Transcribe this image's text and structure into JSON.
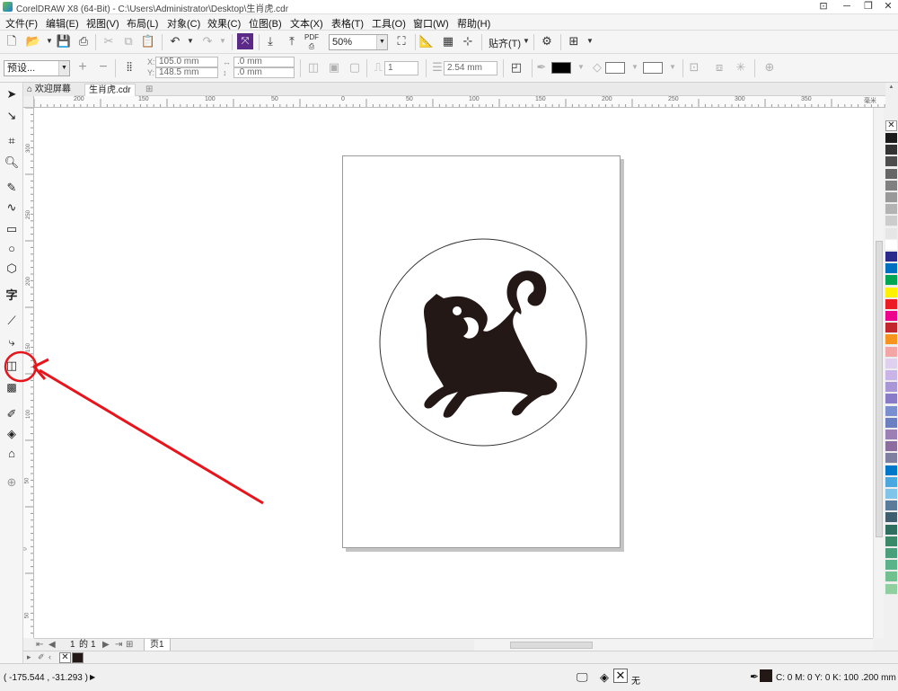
{
  "window": {
    "title": "CorelDRAW X8 (64-Bit) - C:\\Users\\Administrator\\Desktop\\生肖虎.cdr",
    "controls": [
      "restore-icon",
      "minimize-icon",
      "maximize-icon",
      "close-icon"
    ]
  },
  "menu": [
    "文件(F)",
    "编辑(E)",
    "视图(V)",
    "布局(L)",
    "对象(C)",
    "效果(C)",
    "位图(B)",
    "文本(X)",
    "表格(T)",
    "工具(O)",
    "窗口(W)",
    "帮助(H)"
  ],
  "toolbar": {
    "zoom": "50%",
    "snap_label": "贴齐(T)",
    "pdf_label": "PDF"
  },
  "property_bar": {
    "preset": "预设...",
    "x": "105.0 mm",
    "y": "148.5 mm",
    "x_label": "X:",
    "y_label": "Y:",
    "w": ".0 mm",
    "h": ".0 mm",
    "corner_count": "1",
    "outline_width": "2.54 mm"
  },
  "tabs": [
    {
      "label": "欢迎屏幕",
      "icon": "home-icon",
      "active": false
    },
    {
      "label": "生肖虎.cdr",
      "active": true
    }
  ],
  "rulers": {
    "horizontal": [
      "200",
      "150",
      "100",
      "50",
      "0",
      "50",
      "100",
      "150",
      "200",
      "250",
      "300",
      "350"
    ],
    "horizontal_unit": "毫米",
    "vertical": [
      "300",
      "250",
      "200",
      "150",
      "100",
      "50",
      "0",
      "50"
    ]
  },
  "page_nav": {
    "current": "1",
    "of_label": "的",
    "total": "1",
    "page_tab": "页1"
  },
  "status": {
    "coords": "( -175.544 , -31.293 )",
    "fill_label": "无",
    "outline": "C: 0 M: 0 Y: 0 K: 100  .200 mm"
  },
  "drawing": {
    "subject": "tiger-silhouette",
    "fill_color": "#231815",
    "circle_stroke": "#333333"
  },
  "annotation": {
    "color": "#e8141b",
    "target": "contour-tool"
  },
  "palette": [
    "#ffffff",
    "#1a1a1a",
    "#333333",
    "#4d4d4d",
    "#666666",
    "#808080",
    "#999999",
    "#b3b3b3",
    "#cccccc",
    "#e6e6e6",
    "#ffffff",
    "#2a2a8c",
    "#0070c0",
    "#00a651",
    "#fff200",
    "#ed1c24",
    "#ec008c",
    "#c1272d",
    "#f7941d",
    "#f4a6a6",
    "#e0d0f0",
    "#c8b4e6",
    "#a896d6",
    "#8a7bc8",
    "#7a8fd0",
    "#6a80c0",
    "#9b7fb5",
    "#8c6d9e",
    "#7f7f9f",
    "#0077c8",
    "#4aa8e0",
    "#80c4ea",
    "#5b7b9a",
    "#3f5f6f",
    "#2f6f5f",
    "#3a8a6a",
    "#4aa07a",
    "#5ab48a",
    "#70c090",
    "#90d0a0"
  ]
}
